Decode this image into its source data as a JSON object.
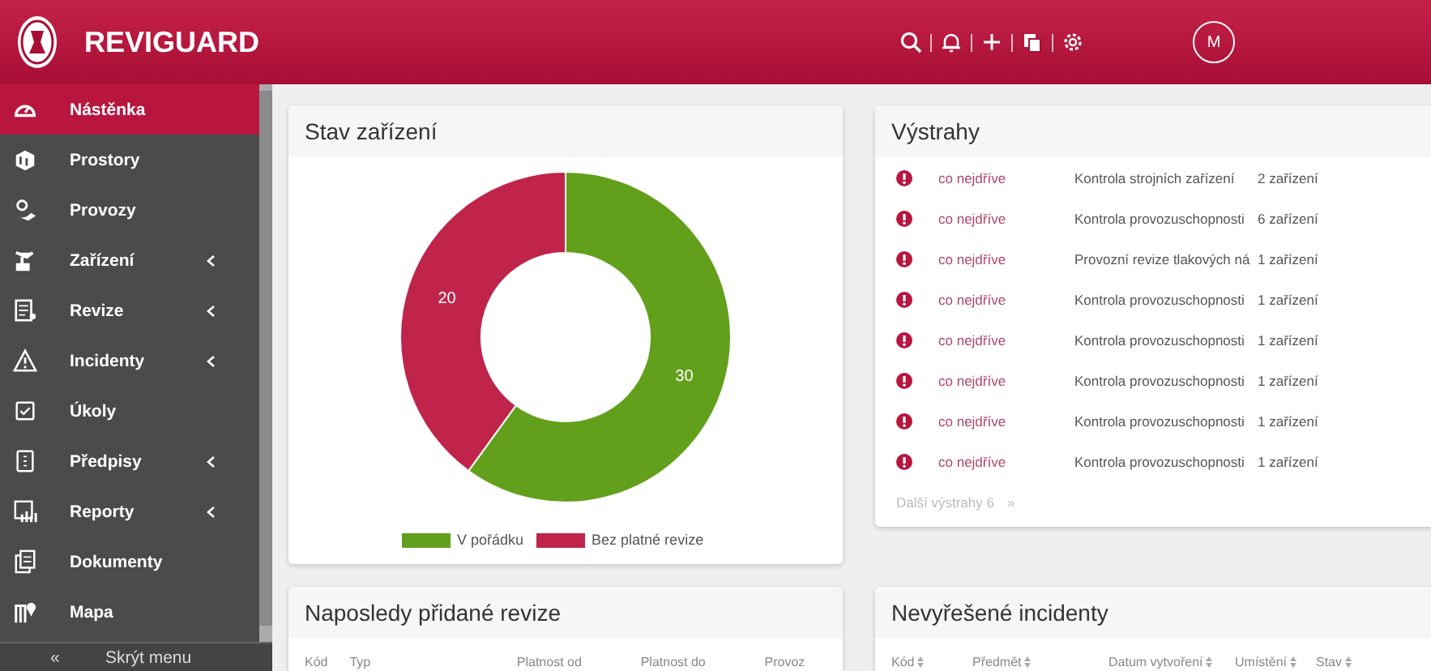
{
  "header": {
    "app_name": "REVIGUARD",
    "avatar": "M"
  },
  "sidebar": {
    "items": [
      {
        "label": "Nástěnka",
        "selected": true,
        "has_submenu": false
      },
      {
        "label": "Prostory",
        "selected": false,
        "has_submenu": false
      },
      {
        "label": "Provozy",
        "selected": false,
        "has_submenu": false
      },
      {
        "label": "Zařízení",
        "selected": false,
        "has_submenu": true
      },
      {
        "label": "Revize",
        "selected": false,
        "has_submenu": true
      },
      {
        "label": "Incidenty",
        "selected": false,
        "has_submenu": true
      },
      {
        "label": "Úkoly",
        "selected": false,
        "has_submenu": false
      },
      {
        "label": "Předpisy",
        "selected": false,
        "has_submenu": true
      },
      {
        "label": "Reporty",
        "selected": false,
        "has_submenu": true
      },
      {
        "label": "Dokumenty",
        "selected": false,
        "has_submenu": false
      },
      {
        "label": "Mapa",
        "selected": false,
        "has_submenu": false
      }
    ],
    "collapse": {
      "icon": "«",
      "label": "Skrýt menu"
    }
  },
  "device_status": {
    "title": "Stav zařízení",
    "chart_data": {
      "type": "donut",
      "categories": [
        "V pořádku",
        "Bez platné revize"
      ],
      "values": [
        30,
        20
      ],
      "colors": [
        "#62a01c",
        "#c0244a"
      ],
      "data_labels": true,
      "legend": "bottom"
    }
  },
  "alerts": {
    "title": "Výstrahy",
    "items": [
      {
        "priority": "co nejdříve",
        "name": "Kontrola strojních zařízení",
        "count": "2 zařízení"
      },
      {
        "priority": "co nejdříve",
        "name": "Kontrola provozuschopnosti",
        "count": "6 zařízení"
      },
      {
        "priority": "co nejdříve",
        "name": "Provozní revize tlakových ná",
        "count": "1 zařízení"
      },
      {
        "priority": "co nejdříve",
        "name": "Kontrola provozuschopnosti",
        "count": "1 zařízení"
      },
      {
        "priority": "co nejdříve",
        "name": "Kontrola provozuschopnosti",
        "count": "1 zařízení"
      },
      {
        "priority": "co nejdříve",
        "name": "Kontrola provozuschopnosti",
        "count": "1 zařízení"
      },
      {
        "priority": "co nejdříve",
        "name": "Kontrola provozuschopnosti",
        "count": "1 zařízení"
      },
      {
        "priority": "co nejdříve",
        "name": "Kontrola provozuschopnosti",
        "count": "1 zařízení"
      }
    ],
    "more": {
      "label": "Další výstrahy 6",
      "icon": "»"
    }
  },
  "recent_revisions": {
    "title": "Naposledy přidané revize",
    "columns": [
      {
        "label": "Kód",
        "sortable": false
      },
      {
        "label": "Typ",
        "sortable": false
      },
      {
        "label": "Platnost od",
        "sortable": false
      },
      {
        "label": "Platnost do",
        "sortable": false
      },
      {
        "label": "Provoz",
        "sortable": false
      }
    ]
  },
  "open_incidents": {
    "title": "Nevyřešené incidenty",
    "columns": [
      {
        "label": "Kód",
        "sortable": true
      },
      {
        "label": "Předmět",
        "sortable": true
      },
      {
        "label": "Datum vytvoření",
        "sortable": true
      },
      {
        "label": "Umístění",
        "sortable": true
      },
      {
        "label": "Stav",
        "sortable": true
      }
    ]
  }
}
